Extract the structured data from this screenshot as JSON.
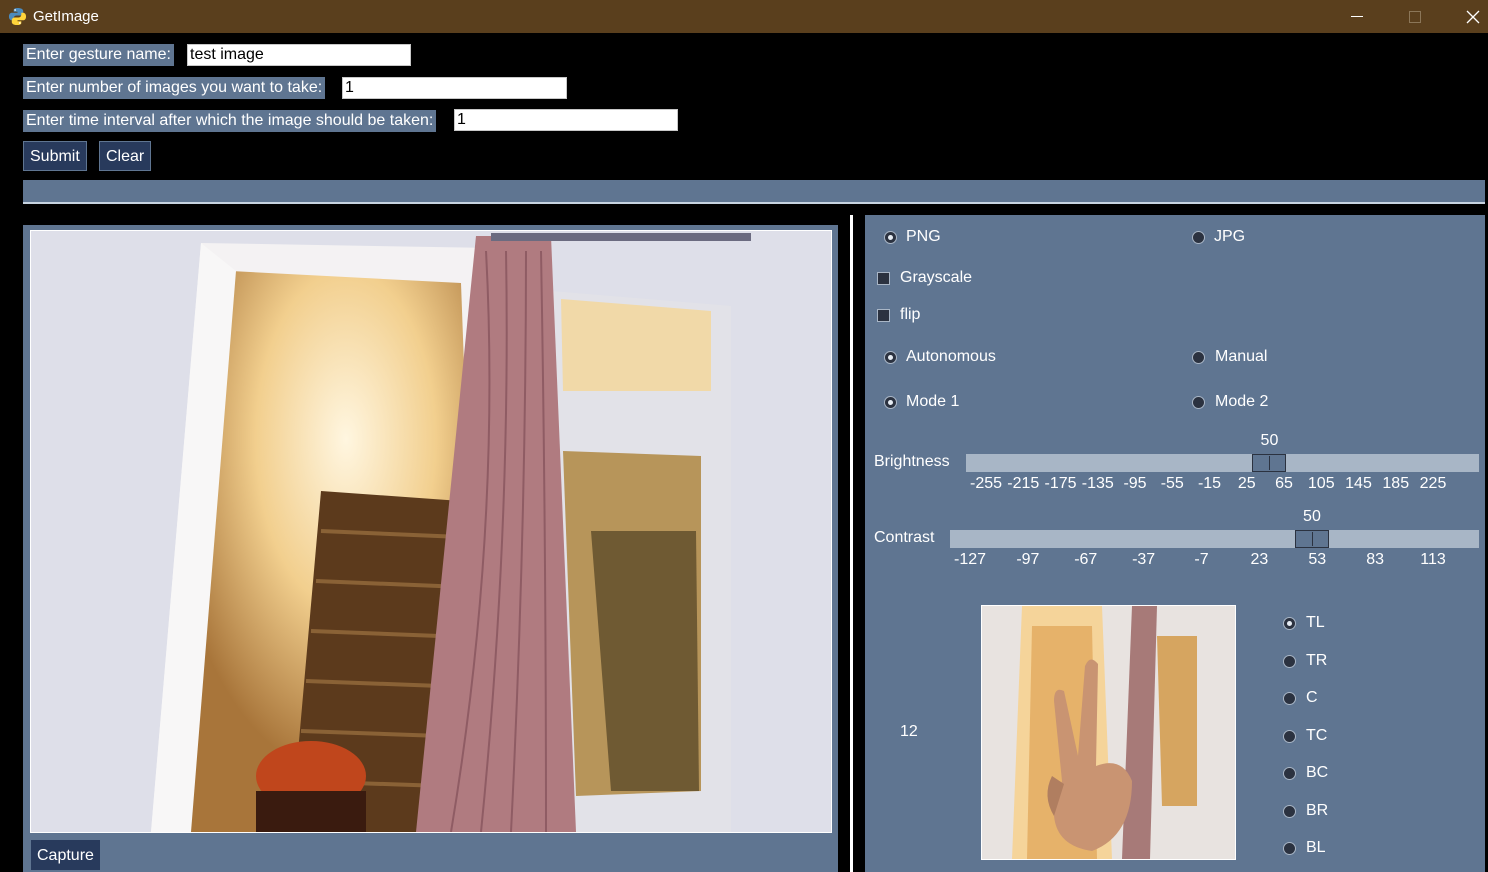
{
  "window": {
    "title": "GetImage"
  },
  "form": {
    "gesture_label": "Enter gesture name:",
    "gesture_value": "test image",
    "count_label": "Enter number of images you want to take:",
    "count_value": "1",
    "interval_label": "Enter time interval after which the image should be taken:",
    "interval_value": "1",
    "submit": "Submit",
    "clear": "Clear"
  },
  "camera": {
    "capture": "Capture"
  },
  "options": {
    "format": {
      "png": "PNG",
      "jpg": "JPG",
      "selected": "PNG"
    },
    "grayscale": "Grayscale",
    "flip": "flip",
    "mode_type": {
      "autonomous": "Autonomous",
      "manual": "Manual",
      "selected": "Autonomous"
    },
    "mode": {
      "mode1": "Mode 1",
      "mode2": "Mode 2",
      "selected": "Mode 1"
    }
  },
  "brightness": {
    "label": "Brightness",
    "value": "50",
    "min": -255,
    "max": 255,
    "ticks": [
      "-255",
      "-215",
      "-175",
      "-135",
      "-95",
      "-55",
      "-15",
      "25",
      "65",
      "105",
      "145",
      "185",
      "225"
    ]
  },
  "contrast": {
    "label": "Contrast",
    "value": "50",
    "min": -127,
    "max": 127,
    "ticks": [
      "-127",
      "-97",
      "-67",
      "-37",
      "-7",
      "23",
      "53",
      "83",
      "113"
    ]
  },
  "counter": "12",
  "positions": {
    "items": [
      "TL",
      "TR",
      "C",
      "TC",
      "BC",
      "BR",
      "BL"
    ],
    "selected": "TL"
  }
}
